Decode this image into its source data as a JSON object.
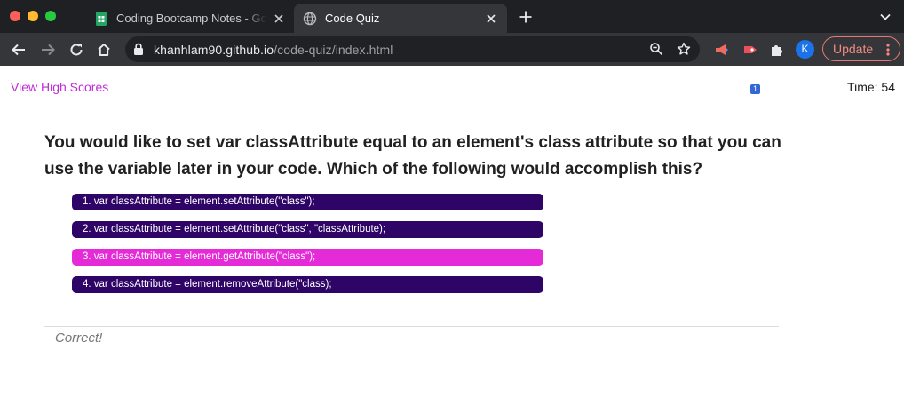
{
  "browser": {
    "tabs": [
      {
        "title": "Coding Bootcamp Notes - Google Sheets",
        "active": false,
        "icon": "sheets-icon"
      },
      {
        "title": "Code Quiz",
        "active": true,
        "icon": "globe-icon"
      }
    ],
    "address": {
      "host": "khanhlam90.github.io",
      "path": "/code-quiz/index.html"
    },
    "extension_badge": "1",
    "profile_initial": "K",
    "update_label": "Update",
    "colors": {
      "tabbar_bg": "#1f2023",
      "toolbar_bg": "#35363a",
      "update_accent": "#f28b82"
    }
  },
  "page": {
    "view_high_scores": "View High Scores",
    "timer": "Time: 54",
    "question": "You would like to set var classAttribute equal to an element's class attribute so that you can use the variable later in your code. Which of the following would accomplish this?",
    "answers": [
      {
        "label": "1. var classAttribute = element.setAttribute(\"class\");",
        "highlighted": false
      },
      {
        "label": "2. var classAttribute = element.setAttribute(\"class\", \"classAttribute);",
        "highlighted": false
      },
      {
        "label": "3. var classAttribute = element.getAttribute(\"class\");",
        "highlighted": true
      },
      {
        "label": "4. var classAttribute = element.removeAttribute(\"class);",
        "highlighted": false
      }
    ],
    "feedback": "Correct!",
    "colors": {
      "link": "#c12bd9",
      "answer_bg": "#2e0567",
      "answer_highlight_bg": "#e52bd8",
      "answer_text": "#ffffff"
    }
  }
}
